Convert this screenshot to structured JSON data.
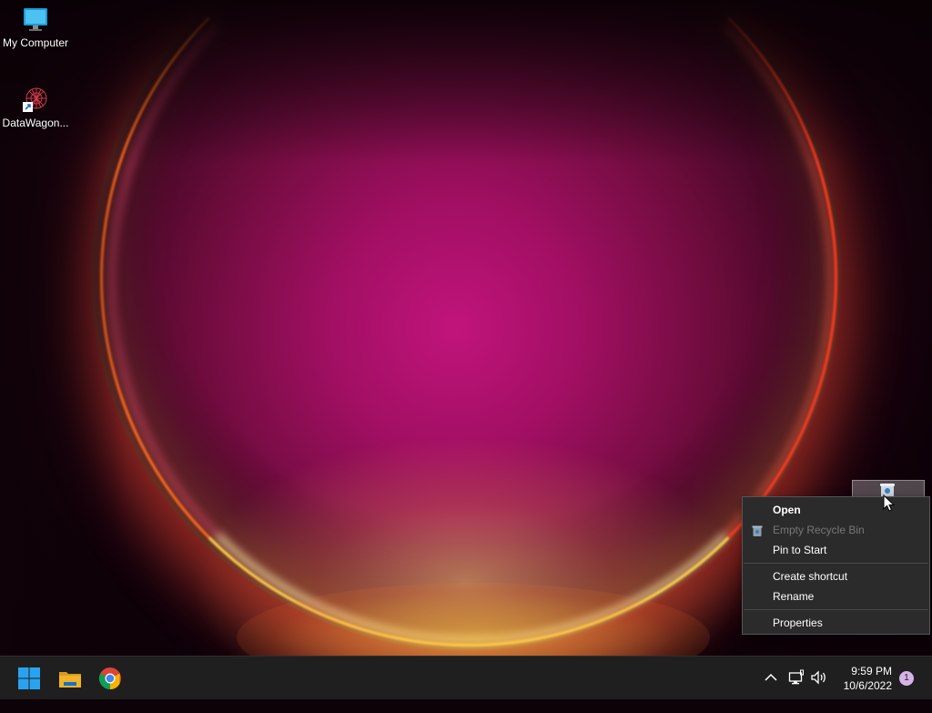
{
  "desktop": {
    "icons": [
      {
        "label": "My Computer",
        "icon": "monitor-icon"
      },
      {
        "label": "DataWagon...",
        "icon": "datawagon-shortcut-icon"
      }
    ],
    "recycle_bin": {
      "icon": "recycle-bin-icon"
    }
  },
  "context_menu": {
    "items": [
      {
        "label": "Open",
        "style": "bold"
      },
      {
        "label": "Empty Recycle Bin",
        "style": "disabled",
        "icon": "recycle-bin-icon"
      },
      {
        "label": "Pin to Start"
      },
      {
        "label": "Create shortcut"
      },
      {
        "label": "Rename"
      },
      {
        "label": "Properties"
      }
    ]
  },
  "taskbar": {
    "apps": [
      {
        "name": "start",
        "icon": "windows-start-icon"
      },
      {
        "name": "file-explorer",
        "icon": "folder-icon"
      },
      {
        "name": "chrome",
        "icon": "chrome-icon"
      }
    ],
    "tray": {
      "icons": [
        "chevron-up-icon",
        "network-icon",
        "volume-icon"
      ],
      "time": "9:59 PM",
      "date": "10/6/2022",
      "notification_count": "1"
    }
  },
  "colors": {
    "taskbar": "#1f1f1f",
    "menu_bg": "#2b2b2b",
    "accent_windows": "#29a3f0",
    "folder": "#f0b429",
    "badge": "#d6b3e6"
  }
}
